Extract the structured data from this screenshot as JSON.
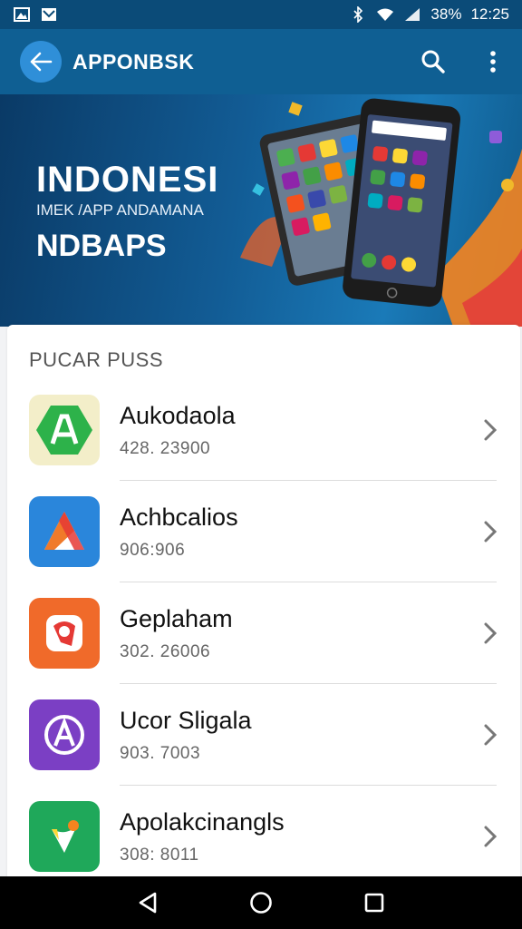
{
  "status_bar": {
    "battery": "38%",
    "time": "12:25",
    "icons": [
      "gallery-icon",
      "mail-icon",
      "bluetooth-icon",
      "wifi-icon",
      "signal-icon"
    ]
  },
  "app_bar": {
    "title": "APPONBSK",
    "icons": [
      "back-arrow-icon",
      "search-icon",
      "more-vert-icon"
    ]
  },
  "banner": {
    "title": "INDONESI",
    "subtitle": "IMEK /APP ANDAMANA",
    "title2": "NDBAPS"
  },
  "section": {
    "title": "PUCAR PUSS"
  },
  "apps": [
    {
      "name": "Aukodaola",
      "size": "428. 23900",
      "icon": "green-a-app-icon",
      "color": "#2db24a"
    },
    {
      "name": "Achbcalios",
      "size": "906:906",
      "icon": "triangle-app-icon",
      "color": "#2a86db"
    },
    {
      "name": "Geplaham",
      "size": "302. 26006",
      "icon": "orange-badge-app-icon",
      "color": "#f06a2a"
    },
    {
      "name": "Ucor Sligala",
      "size": "903. 7003",
      "icon": "purple-a-app-icon",
      "color": "#7b3fc4"
    },
    {
      "name": "Apolakcinangls",
      "size": "308: 8011",
      "icon": "green-leaf-app-icon",
      "color": "#1fa85a"
    }
  ],
  "nav_bar": {
    "icons": [
      "nav-back-icon",
      "nav-home-icon",
      "nav-recents-icon"
    ]
  }
}
